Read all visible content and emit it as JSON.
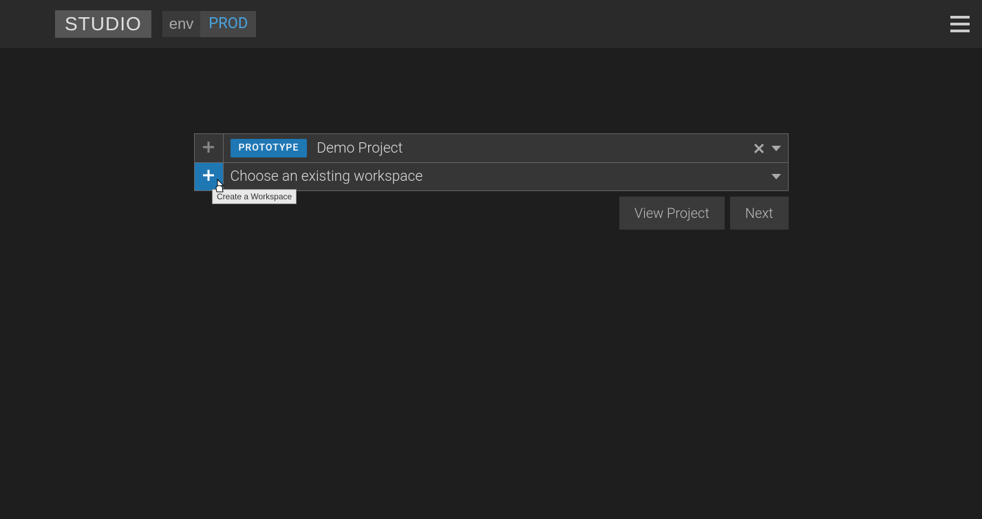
{
  "header": {
    "logo": "STUDIO",
    "env_label": "env",
    "env_value": "PROD"
  },
  "project_row": {
    "badge": "PROTOTYPE",
    "name": "Demo Project"
  },
  "workspace_row": {
    "placeholder": "Choose an existing workspace"
  },
  "tooltip": {
    "text": "Create a Workspace"
  },
  "buttons": {
    "view_project": "View Project",
    "next": "Next"
  }
}
